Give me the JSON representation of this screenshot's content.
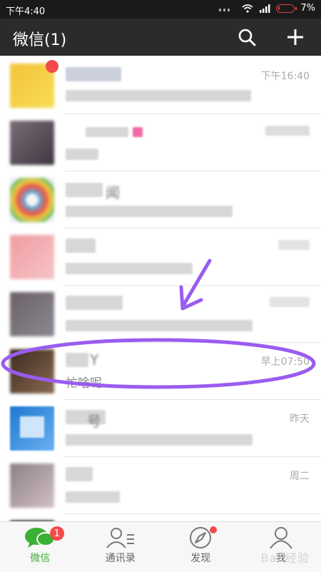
{
  "status_bar": {
    "time": "下午4:40",
    "battery": "7%",
    "battery_level": 0.07
  },
  "header": {
    "title": "微信(1)",
    "icons": [
      "search-icon",
      "plus-icon"
    ]
  },
  "chats": [
    {
      "preview": "",
      "time": "下午16:40"
    },
    {
      "preview": "",
      "time": ""
    },
    {
      "name": "闻",
      "preview": "",
      "time": ""
    },
    {
      "preview": "",
      "time": ""
    },
    {
      "preview": "",
      "time": ""
    },
    {
      "name": "Y",
      "preview": "忙啥呢",
      "time": "早上07:50"
    },
    {
      "name": "号",
      "preview": "",
      "time": "昨天"
    },
    {
      "preview": "",
      "time": "周二"
    }
  ],
  "tabs": [
    {
      "label": "微信",
      "badge": "1",
      "active": true
    },
    {
      "label": "通讯录"
    },
    {
      "label": "发现",
      "dot": true
    },
    {
      "label": "我"
    }
  ],
  "colors": {
    "accent": "#3cb034",
    "header": "#2b2b2b",
    "annotation": "#9a5cf0",
    "badge": "#f24b4b"
  },
  "watermark": "Bai 经验"
}
